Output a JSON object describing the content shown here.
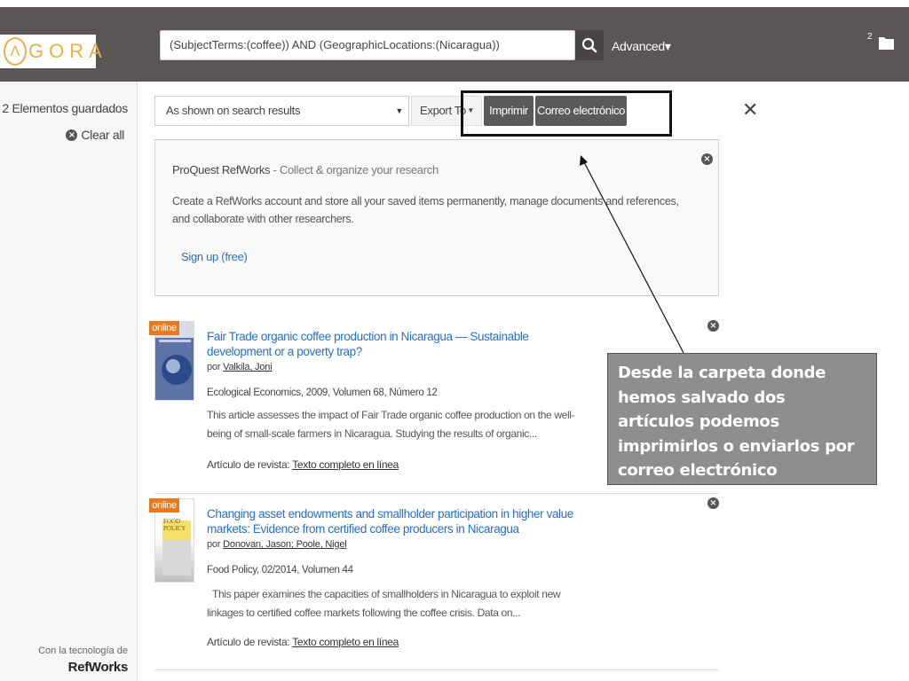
{
  "header": {
    "logo_letter": "Λ",
    "logo_text": "GORA",
    "search_value": "(SubjectTerms:(coffee)) AND (GeographicLocations:(Nicaragua))",
    "advanced_label": "Advanced▾",
    "folder_count": "2"
  },
  "sidebar": {
    "saved_count": "2 Elementos guardados",
    "clear_all": "Clear all",
    "powered_by": "Con la tecnología de",
    "brand": "RefWorks"
  },
  "toolbar": {
    "format_selected": "As shown on search results",
    "export_label": "Export To",
    "print_label": "Imprimir",
    "email_label": "Correo electrónico"
  },
  "refworks_panel": {
    "title": "ProQuest RefWorks",
    "subtitle": " - Collect & organize your research",
    "description": "Create a RefWorks account and store all your saved items permanently, manage documents and references, and collaborate with other researchers.",
    "signup": "Sign up (free)"
  },
  "results": [
    {
      "badge": "online",
      "title": "Fair Trade organic coffee production in Nicaragua — Sustainable development or a poverty trap?",
      "author_prefix": "por ",
      "authors": "Valkila, Joni",
      "source": "Ecological Economics, 2009, Volumen 68, Número 12",
      "abstract": "This article assesses the impact of Fair Trade organic coffee production on the well-being of small-scale farmers in Nicaragua. Studying the results of organic...",
      "type_prefix": "Artículo de revista: ",
      "type_link": "Texto completo en línea"
    },
    {
      "badge": "online",
      "title": "Changing asset endowments and smallholder participation in higher value markets: Evidence from certified coffee producers in Nicaragua",
      "author_prefix": "por ",
      "authors": "Donovan, Jason; Poole, Nigel",
      "source": "Food Policy, 02/2014, Volumen 44",
      "abstract": "  This paper examines the capacities of smallholders in Nicaragua to exploit new linkages to certified coffee markets following the coffee crisis. Data on...",
      "type_prefix": "Artículo de revista: ",
      "type_link": "Texto completo en línea",
      "cover_text": "FOOD POLICY"
    }
  ],
  "callout": {
    "text": "Desde la carpeta donde hemos salvado dos artículos podemos imprimirlos o enviarlos por correo electrónico"
  },
  "colors": {
    "header_bg": "#5b5556",
    "logo_gold": "#e0b24a",
    "link_blue": "#2b6fb8",
    "badge_orange": "#e77a1f",
    "button_dark": "#5a5a5a",
    "callout_bg": "#8e8e8e"
  }
}
